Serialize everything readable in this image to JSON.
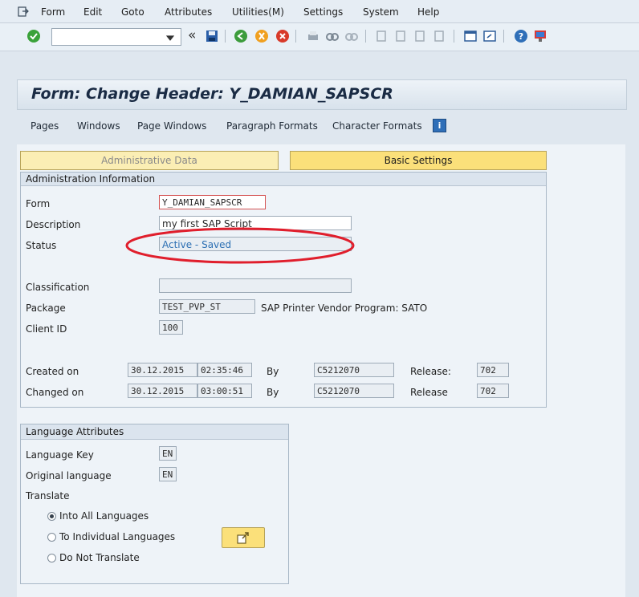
{
  "menu": {
    "items": [
      "Form",
      "Edit",
      "Goto",
      "Attributes",
      "Utilities(M)",
      "Settings",
      "System",
      "Help"
    ]
  },
  "toolbar": {
    "command_value": "",
    "back_icon": "«"
  },
  "title": "Form: Change Header: Y_DAMIAN_SAPSCR",
  "app_toolbar": {
    "items": [
      "Pages",
      "Windows",
      "Page Windows",
      "Paragraph Formats",
      "Character Formats"
    ],
    "info_icon": "i"
  },
  "tabs": {
    "administrative": "Administrative Data",
    "basic": "Basic Settings"
  },
  "admin": {
    "title": "Administration Information",
    "form_label": "Form",
    "form_value": "Y_DAMIAN_SAPSCR",
    "description_label": "Description",
    "description_value": "my first SAP Script",
    "status_label": "Status",
    "status_value": "Active - Saved",
    "classification_label": "Classification",
    "classification_value": "",
    "package_label": "Package",
    "package_value": "TEST_PVP_ST",
    "package_desc": "SAP Printer Vendor Program: SATO",
    "client_label": "Client ID",
    "client_value": "100",
    "created_label": "Created on",
    "created_date": "30.12.2015",
    "created_time": "02:35:46",
    "created_by_label": "By",
    "created_by": "C5212070",
    "created_release_label": "Release:",
    "created_release": "702",
    "changed_label": "Changed on",
    "changed_date": "30.12.2015",
    "changed_time": "03:00:51",
    "changed_by_label": "By",
    "changed_by": "C5212070",
    "changed_release_label": "Release",
    "changed_release": "702"
  },
  "language": {
    "title": "Language Attributes",
    "key_label": "Language Key",
    "key_value": "EN",
    "original_label": "Original language",
    "original_value": "EN",
    "translate_label": "Translate",
    "options": [
      "Into All Languages",
      "To Individual Languages",
      "Do Not Translate"
    ],
    "selected": 0
  },
  "colors": {
    "annotation_red": "#e01e2c",
    "tab_yellow": "#fbe07a",
    "status_blue": "#2c6fb3"
  }
}
